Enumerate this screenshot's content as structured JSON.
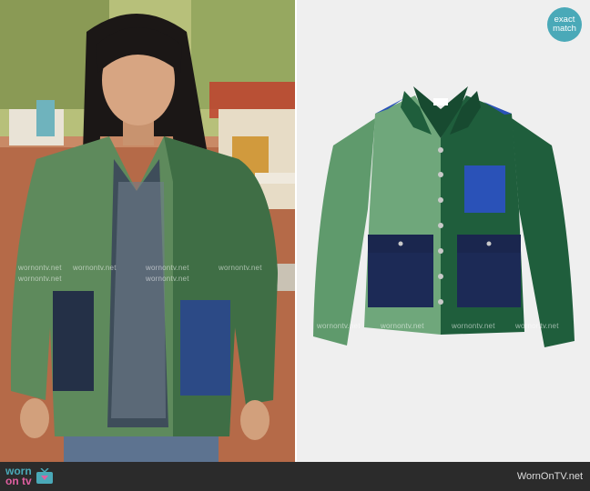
{
  "badge": {
    "line1": "exact",
    "line2": "match"
  },
  "watermarks": {
    "text": "wornontv.net"
  },
  "footer": {
    "logo_top": "worn",
    "logo_bottom": "on tv",
    "site": "WornOnTV.net"
  },
  "colors": {
    "badge": "#4aa9b8",
    "logo_pink": "#e05fa0",
    "footer_bg": "#2b2b2b",
    "jacket_light_green": "#5f9a6c",
    "jacket_dark_green": "#1f5e3c",
    "pocket_navy": "#1c2a56",
    "pocket_blue": "#2a52b8"
  }
}
